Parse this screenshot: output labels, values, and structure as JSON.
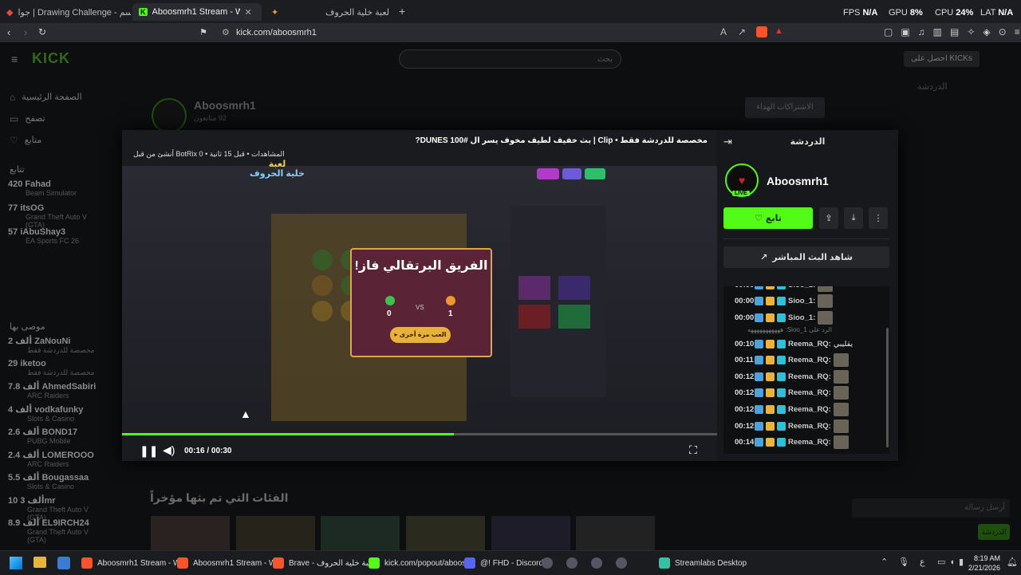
{
  "browser": {
    "tabs": [
      {
        "label": "جوا | Drawing Challenge - تحدي الرسم",
        "active": false
      },
      {
        "label": "Aboosmrh1 Stream - Watch L",
        "active": true
      },
      {
        "label": "لعبة خلية الحروف",
        "active": false
      }
    ],
    "new_tab": "+",
    "url": "kick.com/aboosmrh1"
  },
  "hud": {
    "fps_label": "FPS",
    "fps_value": "N/A",
    "gpu_label": "GPU",
    "gpu_value": "8%",
    "cpu_label": "CPU",
    "cpu_value": "24%",
    "lat_label": "LAT",
    "lat_value": "N/A"
  },
  "site": {
    "logo": "KICK",
    "search_placeholder": "بحث",
    "get_kicks": "احصل على KICKs",
    "nav": [
      {
        "label": "الصفحة الرئيسية",
        "icon": "home-icon"
      },
      {
        "label": "تصفح",
        "icon": "browse-icon"
      },
      {
        "label": "متابع",
        "icon": "heart-icon"
      }
    ],
    "following_heading": "تتابع",
    "following": [
      {
        "name": "Fahad",
        "count": "420",
        "game": "Beam Simulator"
      },
      {
        "name": "itsOG",
        "count": "77",
        "game": "Grand Theft Auto V (GTA)"
      },
      {
        "name": "iAbuShay3",
        "count": "57",
        "game": "EA Sports FC 26"
      }
    ],
    "recommended_heading": "موصى بها",
    "recommended": [
      {
        "name": "ZaNouNi",
        "count": "2 ألف",
        "game": "مخصصة للدردشة فقط"
      },
      {
        "name": "iketoo",
        "count": "29",
        "game": "مخصصة للدردشة فقط"
      },
      {
        "name": "AhmedSabiri",
        "count": "7.8 ألف",
        "game": "ARC Raiders"
      },
      {
        "name": "vodkafunky",
        "count": "4 ألف",
        "game": "Slots & Casino"
      },
      {
        "name": "BOND17",
        "count": "2.6 ألف",
        "game": "PUBG Mobile"
      },
      {
        "name": "LOMEROOO",
        "count": "2.4 ألف",
        "game": "ARC Raiders"
      },
      {
        "name": "Bougassaa",
        "count": "5.5 ألف",
        "game": "Slots & Casino"
      },
      {
        "name": "3mr",
        "count": "10 ألف",
        "game": "Grand Theft Auto V (GTA)"
      },
      {
        "name": "EL9IRCH24",
        "count": "8.9 ألف",
        "game": "Grand Theft Auto V (GTA)"
      }
    ],
    "channel_name": "Aboosmrh1",
    "channel_followers": "92 متابعون",
    "gift_subs": "الاشتراكات الهداء",
    "categories_heading": "الفئات التي تم بثها مؤخراً",
    "chat_heading": "الدردشة",
    "chat_placeholder": "أرسل رسالة",
    "chat_send": "الدردشة"
  },
  "clip": {
    "title": "مخصصة للدردشة فقط • Clip | بث خفيف لطيف مخوف يسر ال #DUNES 100?",
    "meta": "المشاهدات • قبل 15 ثانية • BotRix 0 أنشئ من قبل",
    "game_logo_line1": "لعبة",
    "game_logo_line2": "خلية الحروف",
    "popup_title": "الفريق البرتقالي فاز!",
    "team_green_score": "0",
    "vs": "VS",
    "team_orange_score": "1",
    "play_again": "العب مرة أخرى",
    "progress": 0.557,
    "time": "00:16 / 00:30"
  },
  "panel": {
    "heading": "الدردشة",
    "streamer": "Aboosmrh1",
    "live": "LIVE",
    "follow": "تابع",
    "watch_live": "شاهد البث المباشر",
    "messages": [
      {
        "time": "00:00",
        "user": "Sioo_1:"
      },
      {
        "time": "00:00",
        "user": "Sioo_1:"
      },
      {
        "time": "00:00",
        "user": "Sioo_1:"
      },
      {
        "time": "00:10",
        "user": "Reema_RQ:",
        "text": "يقليبي",
        "reply": "الرد على Sioo_1: هههههههههههه"
      },
      {
        "time": "00:11",
        "user": "Reema_RQ:"
      },
      {
        "time": "00:12",
        "user": "Reema_RQ:"
      },
      {
        "time": "00:12",
        "user": "Reema_RQ:"
      },
      {
        "time": "00:12",
        "user": "Reema_RQ:"
      },
      {
        "time": "00:12",
        "user": "Reema_RQ:"
      },
      {
        "time": "00:14",
        "user": "Reema_RQ:"
      }
    ]
  },
  "taskbar": {
    "apps": [
      {
        "label": "Aboosmrh1 Stream - W",
        "color": "#fb542b"
      },
      {
        "label": "Aboosmrh1 Stream - W",
        "color": "#fb542b"
      },
      {
        "label": "Brave - لعبة خلية الحروف",
        "color": "#fb542b"
      },
      {
        "label": "kick.com/popout/aboos",
        "color": "#53fc18"
      },
      {
        "label": "@! FHD - Discord",
        "color": "#5865f2"
      },
      {
        "label": "Streamlabs Desktop",
        "color": "#31c3a2"
      }
    ],
    "lang": "ع",
    "time": "8:19 AM",
    "date": "2/21/2026"
  }
}
